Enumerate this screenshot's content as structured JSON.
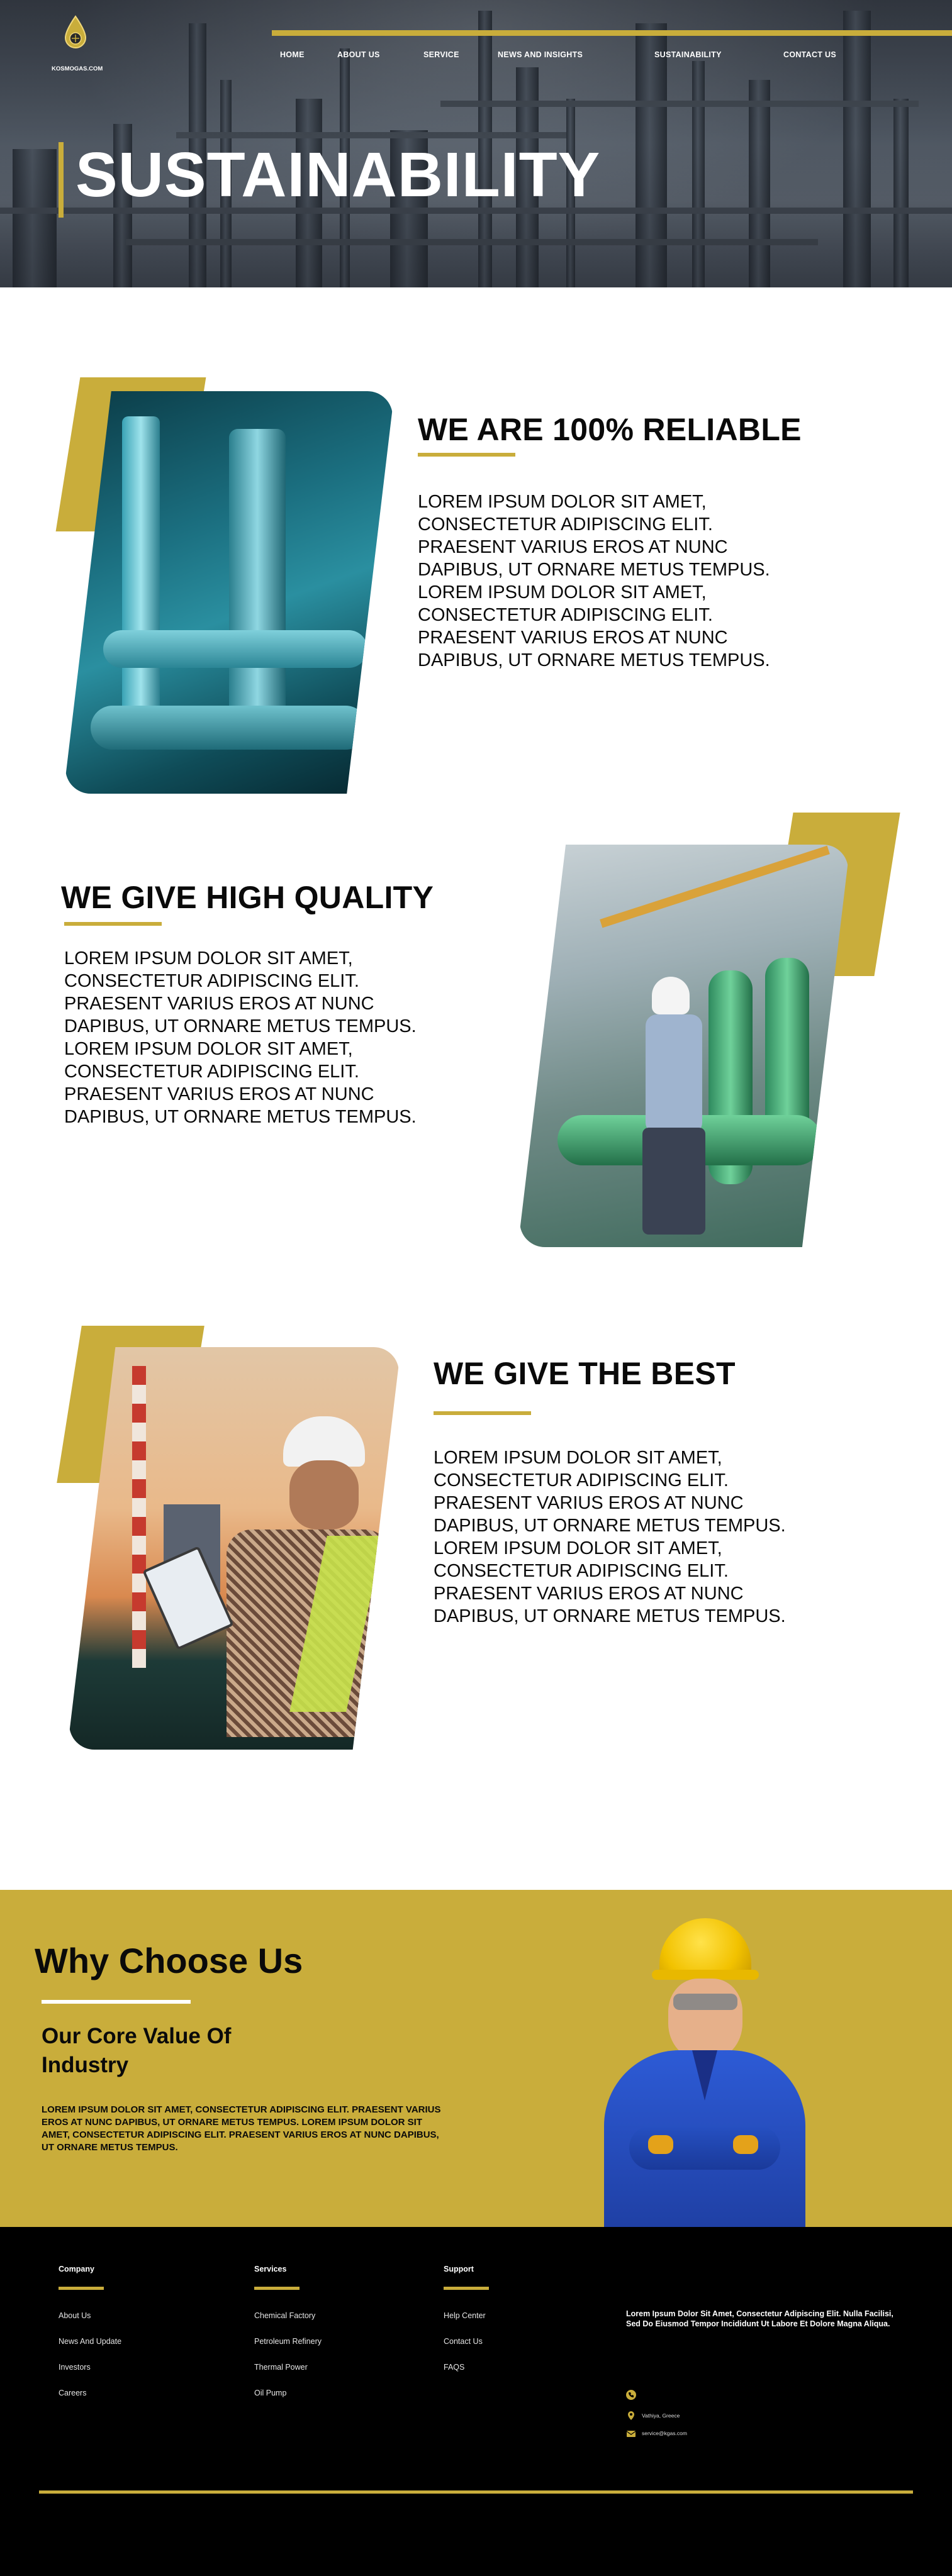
{
  "brand": {
    "logo_text": "KOSMOGAS.COM"
  },
  "nav": {
    "items": [
      "HOME",
      "ABOUT US",
      "SERVICE",
      "NEWS AND INSIGHTS",
      "SUSTAINABILITY",
      "CONTACT US"
    ]
  },
  "hero": {
    "title": "SUSTAINABILITY"
  },
  "sections": [
    {
      "title": "WE ARE 100% RELIABLE",
      "text": "LOREM IPSUM DOLOR SIT AMET, CONSECTETUR ADIPISCING ELIT. PRAESENT VARIUS EROS AT NUNC DAPIBUS, UT ORNARE METUS TEMPUS. LOREM IPSUM DOLOR SIT AMET, CONSECTETUR ADIPISCING ELIT. PRAESENT VARIUS EROS AT NUNC DAPIBUS, UT ORNARE METUS TEMPUS."
    },
    {
      "title": "WE GIVE HIGH QUALITY",
      "text": "LOREM IPSUM DOLOR SIT AMET, CONSECTETUR ADIPISCING ELIT. PRAESENT VARIUS EROS AT NUNC DAPIBUS, UT ORNARE METUS TEMPUS. LOREM IPSUM DOLOR SIT AMET, CONSECTETUR ADIPISCING ELIT. PRAESENT VARIUS EROS AT NUNC DAPIBUS, UT ORNARE METUS TEMPUS."
    },
    {
      "title": "WE GIVE THE BEST",
      "text": "LOREM IPSUM DOLOR SIT AMET, CONSECTETUR ADIPISCING ELIT. PRAESENT VARIUS EROS AT NUNC DAPIBUS, UT ORNARE METUS TEMPUS. LOREM IPSUM DOLOR SIT AMET, CONSECTETUR ADIPISCING ELIT. PRAESENT VARIUS EROS AT NUNC DAPIBUS, UT ORNARE METUS TEMPUS."
    }
  ],
  "why": {
    "title": "Why Choose Us",
    "subtitle": "Our Core Value Of Industry",
    "text": "LOREM IPSUM DOLOR SIT AMET, CONSECTETUR ADIPISCING ELIT. PRAESENT VARIUS EROS AT NUNC DAPIBUS, UT ORNARE METUS TEMPUS. LOREM IPSUM DOLOR SIT AMET, CONSECTETUR ADIPISCING ELIT. PRAESENT VARIUS EROS AT NUNC DAPIBUS, UT ORNARE METUS TEMPUS."
  },
  "footer": {
    "columns": [
      {
        "heading": "Company",
        "links": [
          "About Us",
          "News And Update",
          "Investors",
          "Careers"
        ]
      },
      {
        "heading": "Services",
        "links": [
          "Chemical Factory",
          "Petroleum Refinery",
          "Thermal Power",
          "Oil Pump"
        ]
      },
      {
        "heading": "Support",
        "links": [
          "Help Center",
          "Contact Us",
          "FAQS"
        ]
      }
    ],
    "about": "Lorem Ipsum Dolor Sit Amet, Consectetur Adipiscing Elit. Nulla Facilisi, Sed Do Eiusmod Tempor Incididunt Ut Labore Et Dolore Magna Aliqua.",
    "contact": {
      "phone": "",
      "address": "Vathiya, Greece",
      "email": "service@kgas.com"
    }
  },
  "colors": {
    "accent": "#c9ad3b",
    "footer_bg": "#000000",
    "text": "#0a0a0a"
  },
  "icons": [
    "logo-drop-icon",
    "phone-icon",
    "location-pin-icon",
    "email-icon"
  ]
}
